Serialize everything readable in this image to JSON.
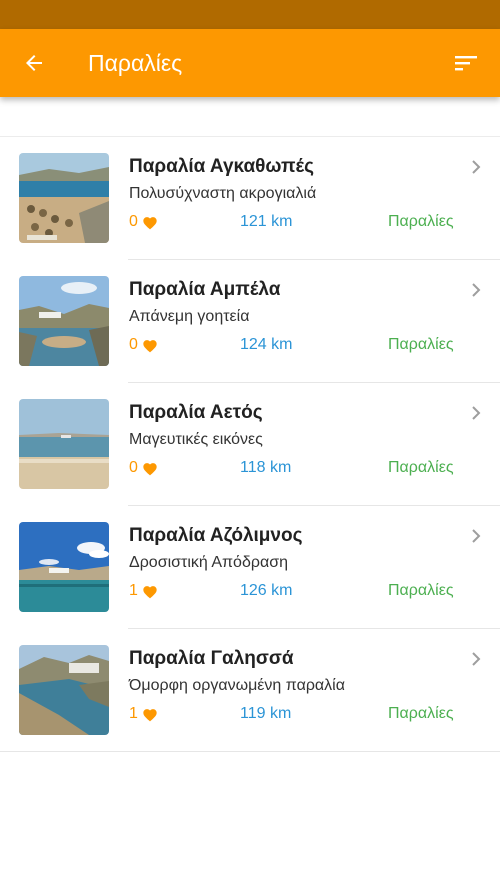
{
  "app_bar": {
    "title": "Παραλίες",
    "back_icon": "arrow-left-icon",
    "sort_icon": "sort-icon"
  },
  "colors": {
    "status_bar": "#b06a00",
    "accent": "#fd9801",
    "distance": "#2b94d6",
    "category": "#4caf50"
  },
  "beaches": [
    {
      "title": "Παραλία Αγκαθωπές",
      "subtitle": "Πολυσύχναστη ακρογιαλιά",
      "likes": "0",
      "distance": "121 km",
      "category": "Παραλίες"
    },
    {
      "title": "Παραλία Αμπέλα",
      "subtitle": "Απάνεμη γοητεία",
      "likes": "0",
      "distance": "124 km",
      "category": "Παραλίες"
    },
    {
      "title": "Παραλία Αετός",
      "subtitle": "Μαγευτικές εικόνες",
      "likes": "0",
      "distance": "118 km",
      "category": "Παραλίες"
    },
    {
      "title": "Παραλία Αζόλιμνος",
      "subtitle": "Δροσιστική Απόδραση",
      "likes": "1",
      "distance": "126 km",
      "category": "Παραλίες"
    },
    {
      "title": "Παραλία Γαλησσά",
      "subtitle": "Όμορφη οργανωμένη παραλία",
      "likes": "1",
      "distance": "119 km",
      "category": "Παραλίες"
    }
  ]
}
